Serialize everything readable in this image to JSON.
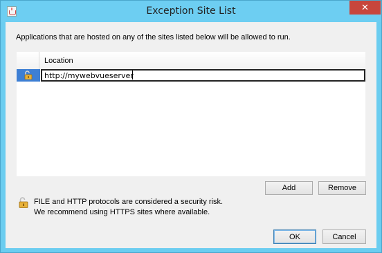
{
  "window": {
    "title": "Exception Site List",
    "app_icon": "java-cup-icon",
    "close_label": "✕"
  },
  "dialog": {
    "intro": "Applications that are hosted on any of the sites listed below will be allowed to run.",
    "table": {
      "columns": [
        "",
        "Location"
      ],
      "rows": [
        {
          "icon": "unlocked-padlock-icon",
          "location": "http://mywebvueserver",
          "editing": true
        }
      ]
    },
    "buttons": {
      "add": "Add",
      "remove": "Remove",
      "ok": "OK",
      "cancel": "Cancel"
    },
    "warning": {
      "icon": "unlocked-padlock-icon",
      "line1": "FILE and HTTP protocols are considered a security risk.",
      "line2": "We recommend using HTTPS sites where available."
    }
  },
  "colors": {
    "titlebar": "#6dcef2",
    "close": "#c7463c",
    "selection": "#3d7fd4",
    "client": "#f0f0f0"
  }
}
